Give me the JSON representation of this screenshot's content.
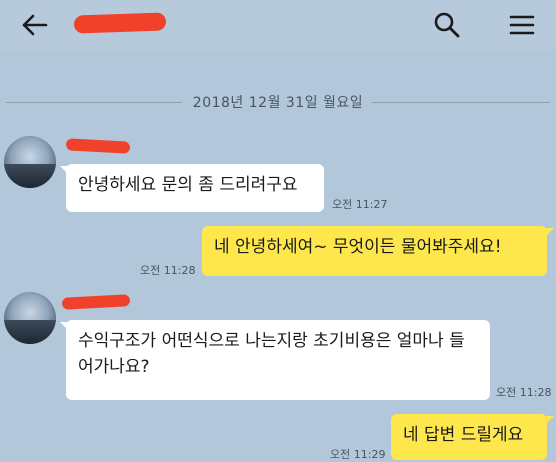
{
  "header": {
    "title": "",
    "back_icon": "arrow-left-icon",
    "search_icon": "search-icon",
    "menu_icon": "hamburger-menu-icon"
  },
  "date_separator": "2018년 12월 31일 월요일",
  "messages": [
    {
      "side": "in",
      "sender": "",
      "text": "안녕하세요 문의 좀 드리려구요",
      "time": "오전 11:27"
    },
    {
      "side": "out",
      "text": "네 안녕하세여~ 무엇이든 물어봐주세요!",
      "time": "오전 11:28"
    },
    {
      "side": "in",
      "sender": "",
      "text": "수익구조가 어떤식으로 나는지랑 초기비용은 얼마나 들어가나요?",
      "time": "오전 11:28"
    },
    {
      "side": "out",
      "text": "네 답변 드릴게요",
      "time": "오전 11:29"
    }
  ],
  "colors": {
    "background": "#b2c7da",
    "outgoing_bubble": "#fde74c",
    "incoming_bubble": "#ffffff",
    "redaction": "#f0412a"
  }
}
